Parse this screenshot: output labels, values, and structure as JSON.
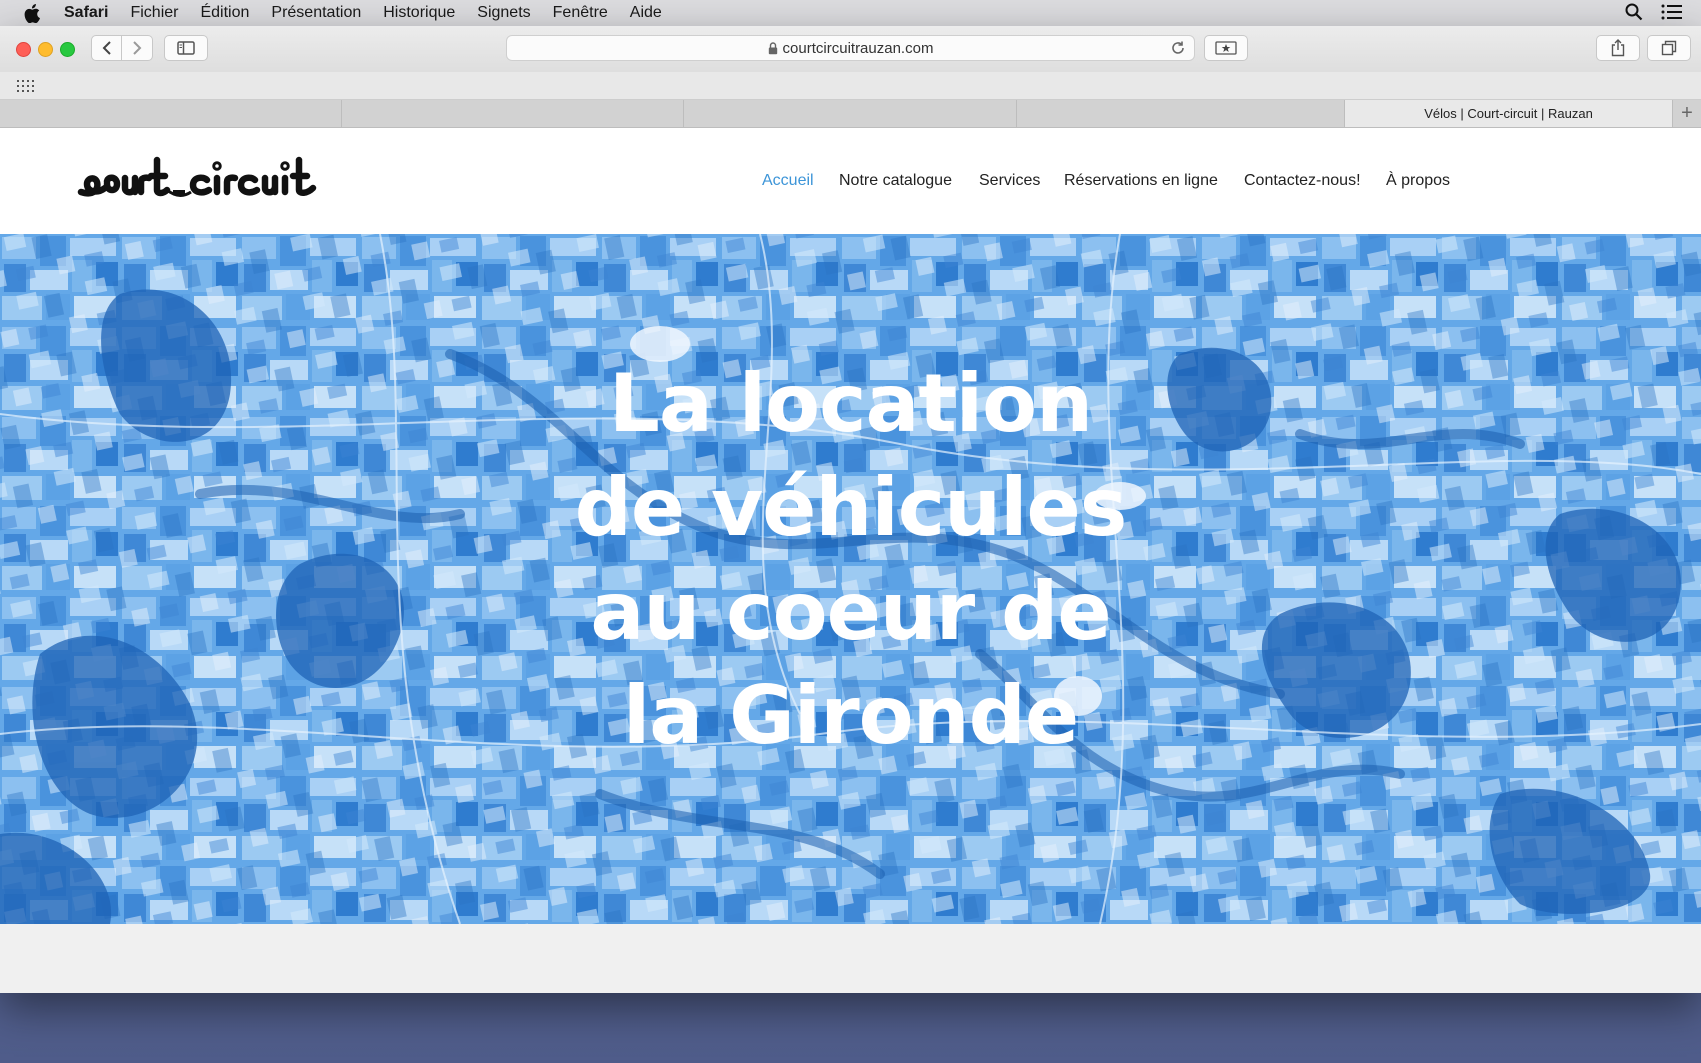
{
  "menubar": {
    "app": "Safari",
    "items": [
      "Fichier",
      "Édition",
      "Présentation",
      "Historique",
      "Signets",
      "Fenêtre",
      "Aide"
    ],
    "icons": [
      "apple-icon",
      "search-icon",
      "list-icon"
    ]
  },
  "browser": {
    "url": "courtcircuitrauzan.com",
    "active_tab_title": "Vélos | Court-circuit | Rauzan",
    "tab_plus": "+"
  },
  "site": {
    "logo_text": "court circuit",
    "nav": [
      "Accueil",
      "Notre catalogue",
      "Services",
      "Réservations en ligne",
      "Contactez-nous!",
      "À propos"
    ],
    "active_nav": "Accueil",
    "accent": "#3d95d8"
  },
  "hero": {
    "lines": [
      "La location",
      "de véhicules",
      "au coeur de",
      "la Gironde"
    ],
    "tint": "#5da3e6"
  }
}
